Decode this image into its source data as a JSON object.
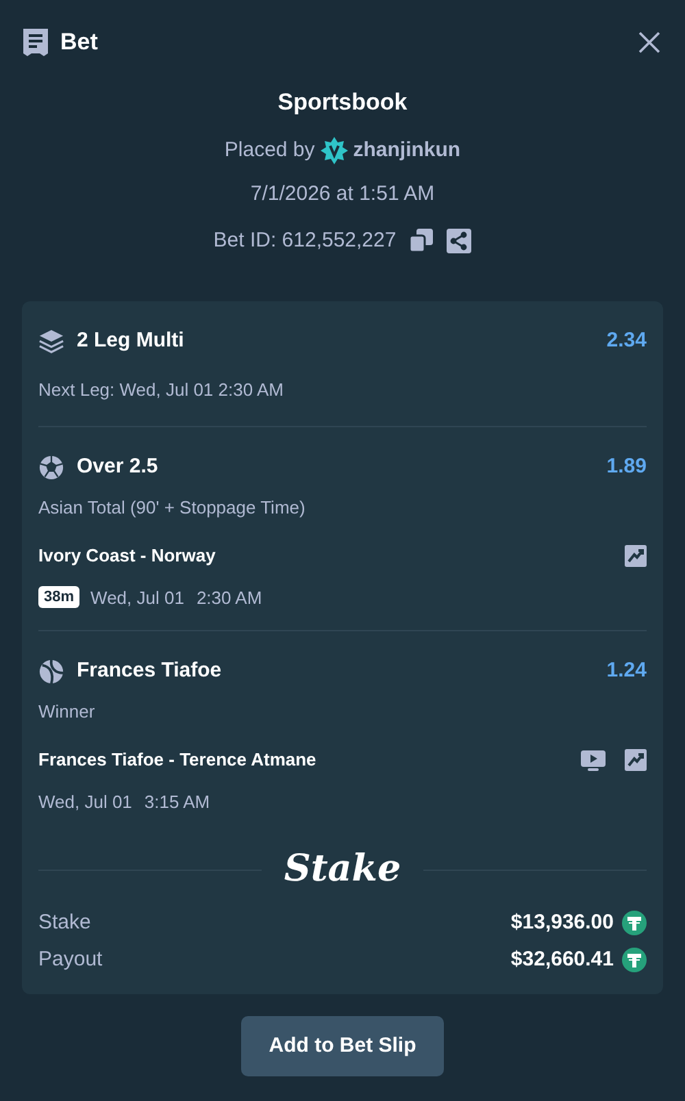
{
  "header": {
    "title": "Bet"
  },
  "summary": {
    "title": "Sportsbook",
    "placed_by": "Placed by",
    "user": "zhanjinkun",
    "date": "7/1/2026 at 1:51 AM",
    "bet_id": "Bet ID: 612,552,227"
  },
  "multi": {
    "title": "2 Leg Multi",
    "odds": "2.34",
    "next_leg": "Next Leg: Wed, Jul 01 2:30 AM"
  },
  "legs": [
    {
      "kind": "soccer",
      "selection": "Over 2.5",
      "odds": "1.89",
      "market": "Asian Total (90' + Stoppage Time)",
      "event": "Ivory Coast - Norway",
      "badge": "38m",
      "date": "Wed, Jul 01",
      "time": "2:30 AM",
      "stream": false
    },
    {
      "kind": "tennis",
      "selection": "Frances Tiafoe",
      "odds": "1.24",
      "market": "Winner",
      "event": "Frances Tiafoe - Terence Atmane",
      "date": "Wed, Jul 01",
      "time": "3:15 AM",
      "stream": true
    }
  ],
  "logo": "Stake",
  "totals": [
    {
      "label": "Stake",
      "amount": "$13,936.00"
    },
    {
      "label": "Payout",
      "amount": "$32,660.41"
    }
  ],
  "action": "Add to Bet Slip"
}
